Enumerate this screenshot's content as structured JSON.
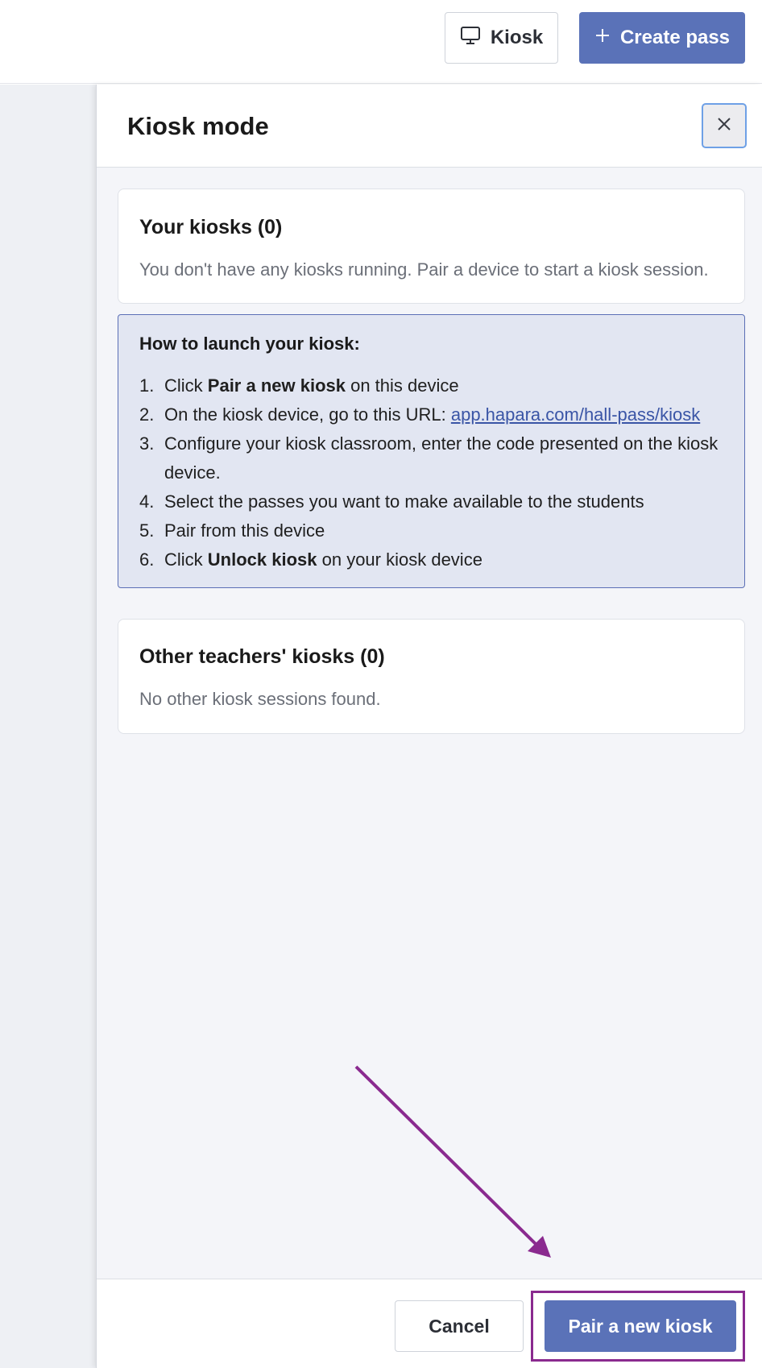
{
  "header": {
    "kiosk_label": "Kiosk",
    "create_pass_label": "Create pass"
  },
  "drawer": {
    "title": "Kiosk mode",
    "your_kiosks": {
      "title": "Your kiosks (0)",
      "message": "You don't have any kiosks running. Pair a device to start a kiosk session."
    },
    "howto": {
      "title": "How to launch your kiosk:",
      "steps": [
        {
          "num": "1.",
          "pre": "Click ",
          "bold": "Pair a new kiosk",
          "post": " on this device"
        },
        {
          "num": "2.",
          "pre": "On the kiosk device, go to this URL: ",
          "link": "app.hapara.com/hall-pass/kiosk"
        },
        {
          "num": "3.",
          "text": "Configure your kiosk classroom, enter the code presented on the kiosk device."
        },
        {
          "num": "4.",
          "text": "Select the passes you want to make available to the students"
        },
        {
          "num": "5.",
          "text": "Pair from this device"
        },
        {
          "num": "6.",
          "pre": "Click ",
          "bold": "Unlock kiosk",
          "post": " on your kiosk device"
        }
      ]
    },
    "other_kiosks": {
      "title": "Other teachers' kiosks (0)",
      "message": "No other kiosk sessions found."
    },
    "footer": {
      "cancel_label": "Cancel",
      "pair_label": "Pair a new kiosk"
    }
  },
  "colors": {
    "primary": "#5a72b8",
    "annotation": "#8a2a8f",
    "info_bg": "#e2e6f2"
  }
}
